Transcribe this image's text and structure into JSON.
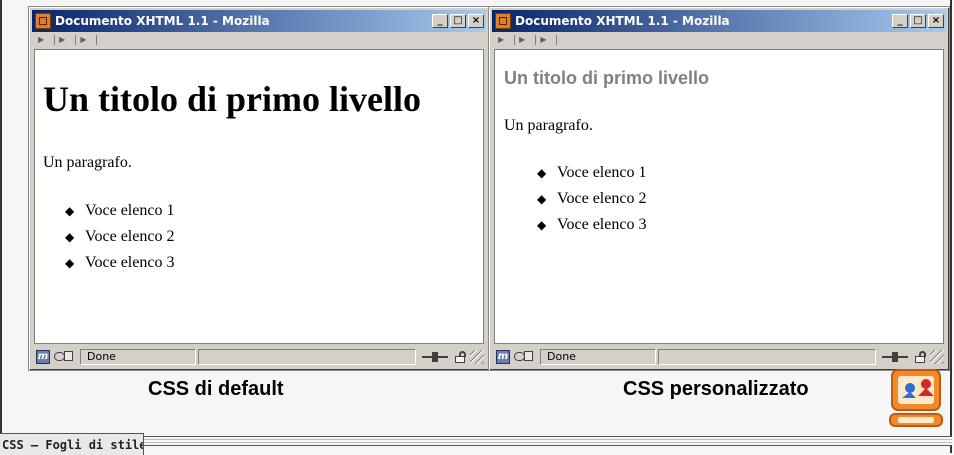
{
  "windows": [
    {
      "title": "Documento XHTML 1.1 - Mozilla",
      "heading": "Un titolo di primo livello",
      "paragraph": "Un paragrafo.",
      "list_items": [
        "Voce elenco 1",
        "Voce elenco 2",
        "Voce elenco 3"
      ],
      "status": "Done"
    },
    {
      "title": "Documento XHTML 1.1 - Mozilla",
      "heading": "Un titolo di primo livello",
      "paragraph": "Un paragrafo.",
      "list_items": [
        "Voce elenco 1",
        "Voce elenco 2",
        "Voce elenco 3"
      ],
      "status": "Done"
    }
  ],
  "captions": {
    "left": "CSS di default",
    "right": "CSS personalizzato"
  },
  "footer": {
    "tab_label": "CSS – Fogli di stile"
  },
  "titlebar_buttons": {
    "minimize": "_",
    "maximize": "□",
    "close": "×"
  },
  "colors": {
    "titlebar_start": "#0a246a",
    "titlebar_end": "#a6caf0",
    "custom_heading": "#808080"
  }
}
